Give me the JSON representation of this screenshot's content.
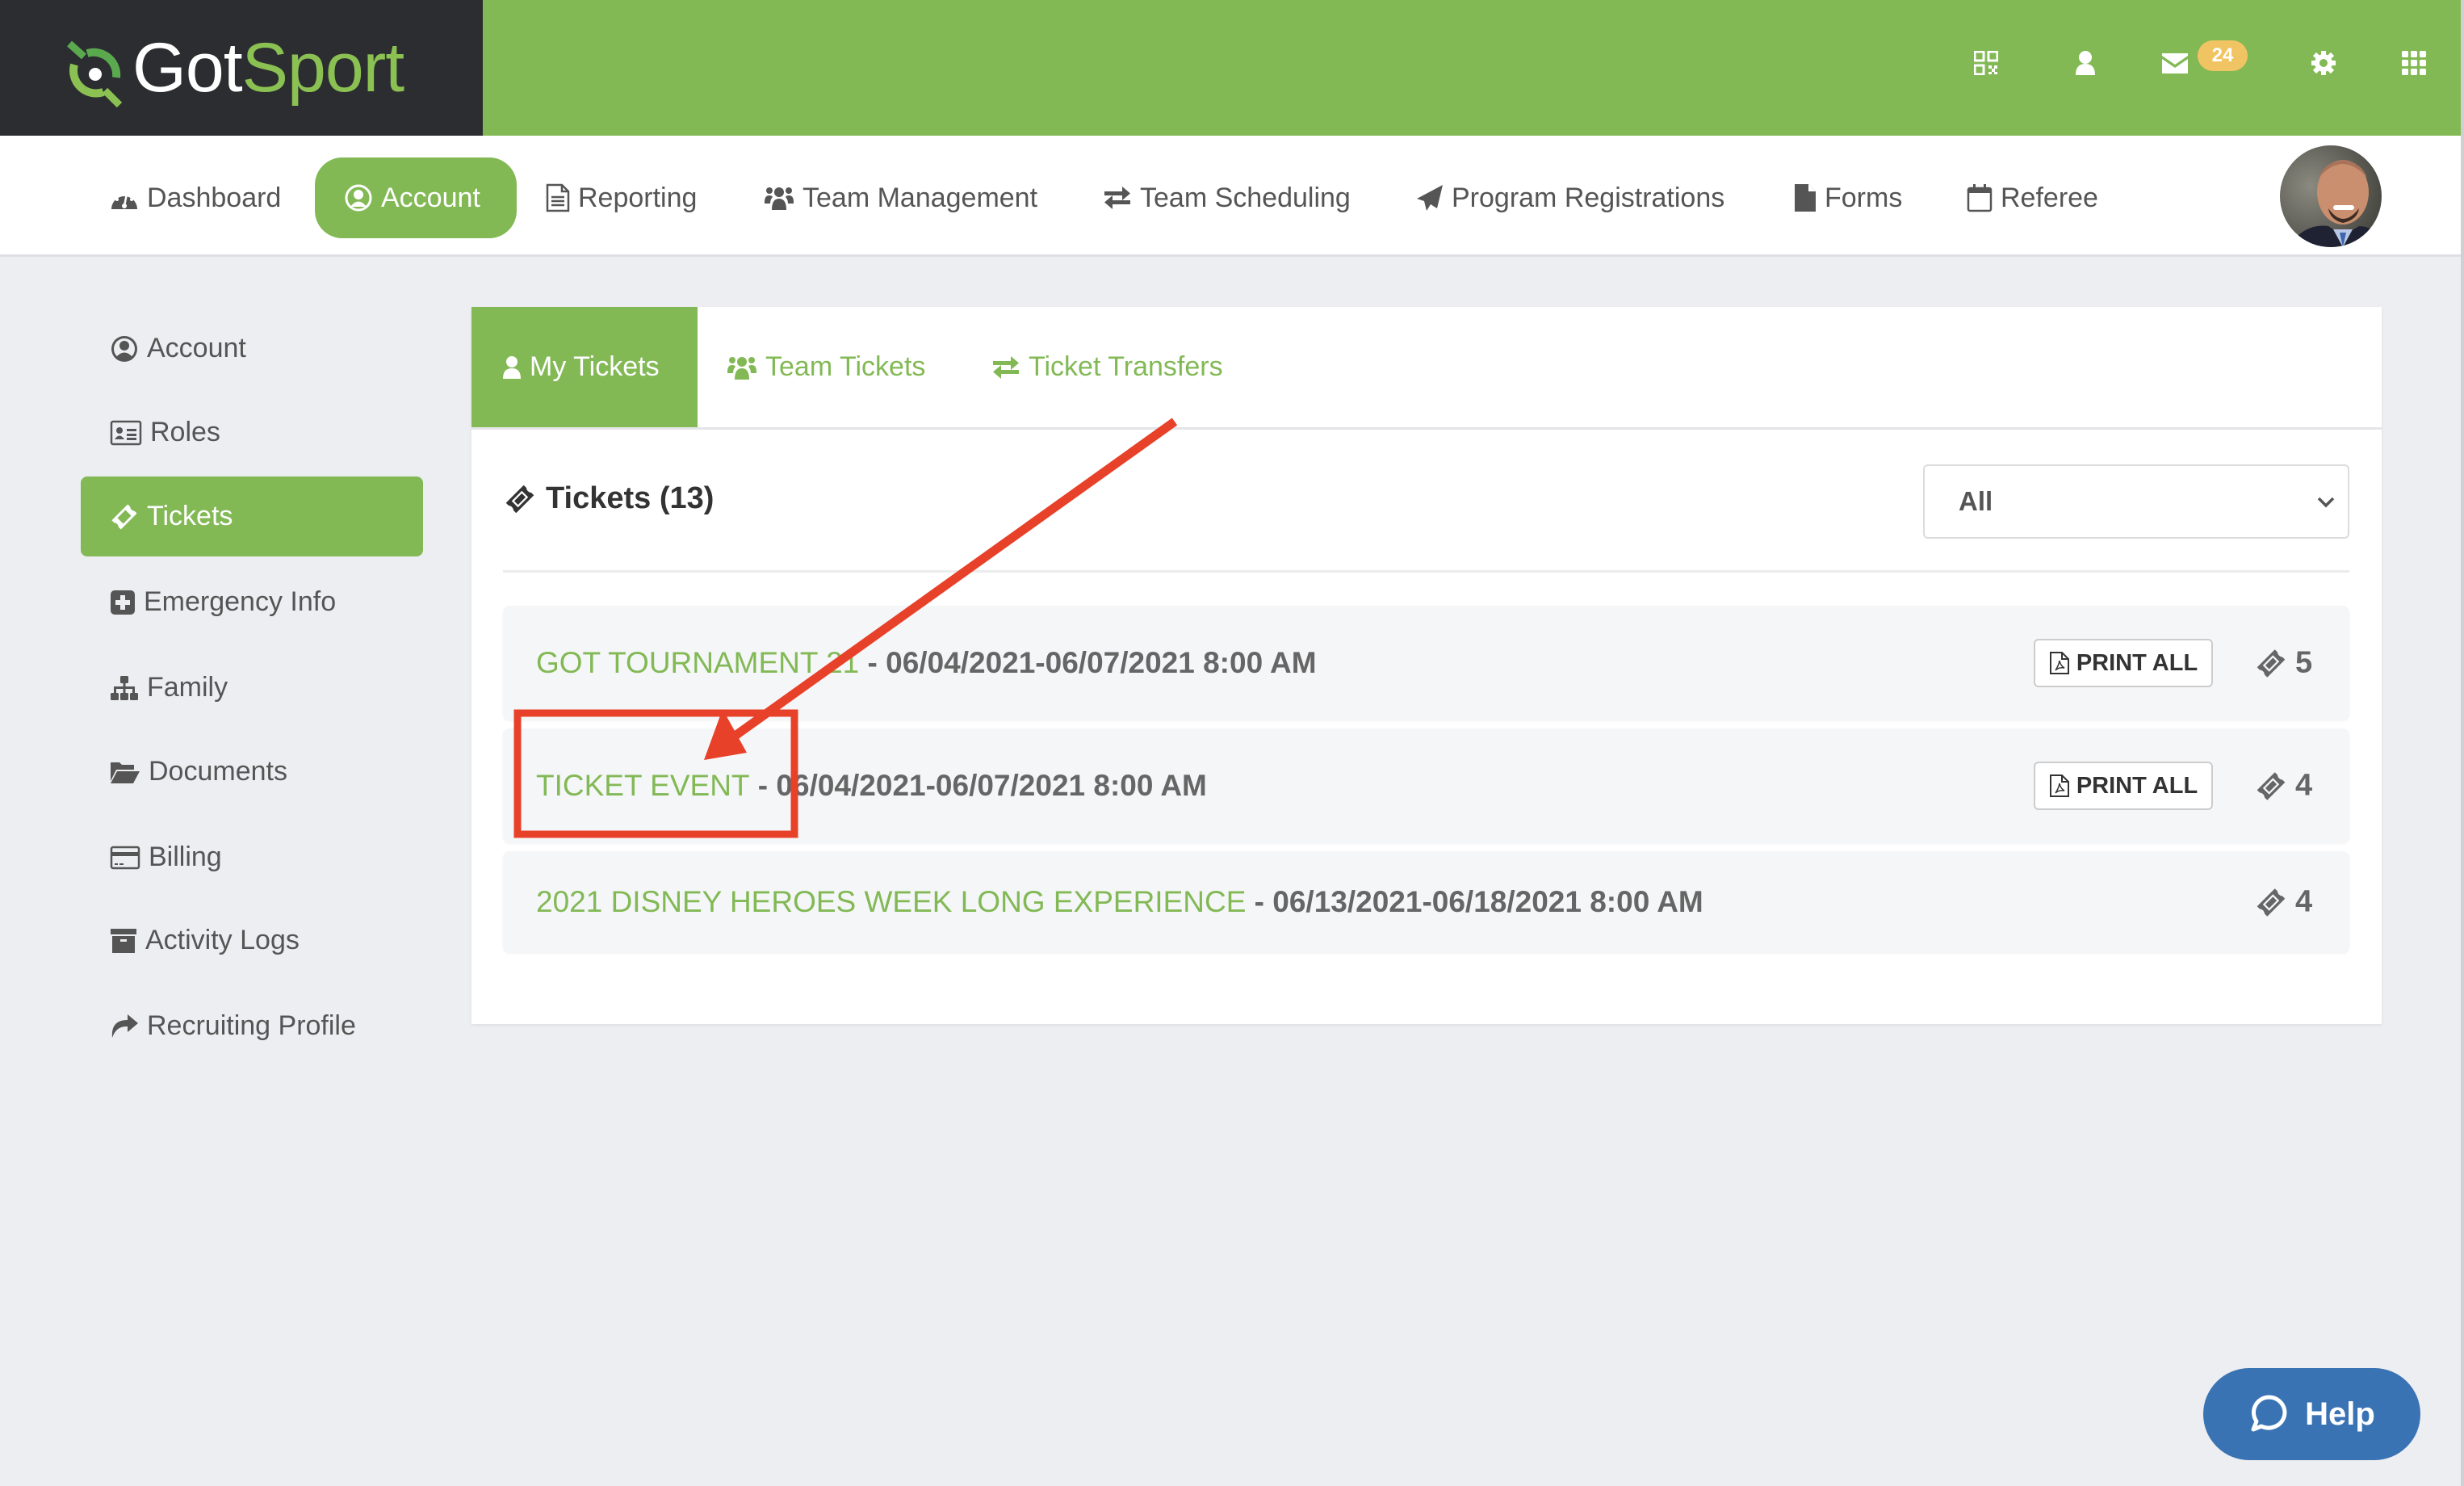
{
  "brand": {
    "got": "Got",
    "sport": "Sport"
  },
  "top_icons": {
    "qr": "qr-code-icon",
    "user": "user-icon",
    "mail": "envelope-icon",
    "mail_badge": "24",
    "settings": "gear-icon",
    "apps": "grid-icon"
  },
  "nav": {
    "items": [
      {
        "label": "Dashboard",
        "icon": "dashboard-icon"
      },
      {
        "label": "Account",
        "icon": "user-circle-icon",
        "active": true
      },
      {
        "label": "Reporting",
        "icon": "document-icon"
      },
      {
        "label": "Team Management",
        "icon": "users-icon"
      },
      {
        "label": "Team Scheduling",
        "icon": "exchange-icon"
      },
      {
        "label": "Program Registrations",
        "icon": "paper-plane-icon"
      },
      {
        "label": "Forms",
        "icon": "file-icon"
      },
      {
        "label": "Referee",
        "icon": "calendar-icon"
      }
    ]
  },
  "sidebar": {
    "items": [
      {
        "label": "Account",
        "icon": "user-circle-icon"
      },
      {
        "label": "Roles",
        "icon": "id-card-icon"
      },
      {
        "label": "Tickets",
        "icon": "ticket-icon",
        "active": true
      },
      {
        "label": "Emergency Info",
        "icon": "plus-square-icon"
      },
      {
        "label": "Family",
        "icon": "sitemap-icon"
      },
      {
        "label": "Documents",
        "icon": "folder-open-icon"
      },
      {
        "label": "Billing",
        "icon": "credit-card-icon"
      },
      {
        "label": "Activity Logs",
        "icon": "archive-icon"
      },
      {
        "label": "Recruiting Profile",
        "icon": "share-icon"
      }
    ]
  },
  "tabs": [
    {
      "label": "My Tickets",
      "icon": "user-icon",
      "active": true
    },
    {
      "label": "Team Tickets",
      "icon": "users-icon"
    },
    {
      "label": "Ticket Transfers",
      "icon": "exchange-icon"
    }
  ],
  "tickets": {
    "title": "Tickets (13)",
    "filter": {
      "selected": "All"
    },
    "print_label": "PRINT ALL",
    "rows": [
      {
        "name": "GOT TOURNAMENT 21",
        "dates": " - 06/04/2021-06/07/2021 8:00 AM",
        "count": "5",
        "printable": true
      },
      {
        "name": "TICKET EVENT",
        "dates": " - 06/04/2021-06/07/2021 8:00 AM",
        "count": "4",
        "printable": true
      },
      {
        "name": "2021 DISNEY HEROES WEEK LONG EXPERIENCE",
        "dates": " - 06/13/2021-06/18/2021 8:00 AM",
        "count": "4",
        "printable": false
      }
    ]
  },
  "help": {
    "label": "Help"
  },
  "colors": {
    "brand_green": "#82b955",
    "dark": "#2c2d31",
    "badge": "#f1c463",
    "help_blue": "#3a73b4",
    "annotation_red": "#e8412a"
  }
}
